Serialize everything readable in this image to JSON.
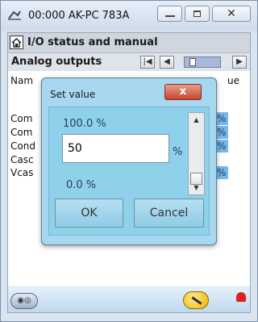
{
  "window": {
    "title": "00:000 AK-PC 783A"
  },
  "header": {
    "title": "I/O status and manual"
  },
  "subheader": {
    "title": "Analog outputs"
  },
  "list": {
    "column_name": "Nam",
    "column_value_fragment": "ue",
    "rows": [
      "Com",
      "Com",
      "Cond",
      "Casc",
      "Vcas"
    ],
    "values": [
      "%",
      "%",
      "%",
      "",
      "%"
    ]
  },
  "dialog": {
    "title": "Set value",
    "max": "100.0 %",
    "min": "0.0 %",
    "input_value": "50",
    "unit": "%",
    "ok_label": "OK",
    "cancel_label": "Cancel",
    "close_label": "x"
  },
  "icons": {
    "home": "home-icon",
    "tool": "wrench-icon",
    "alarm": "alarm-bell-icon"
  }
}
